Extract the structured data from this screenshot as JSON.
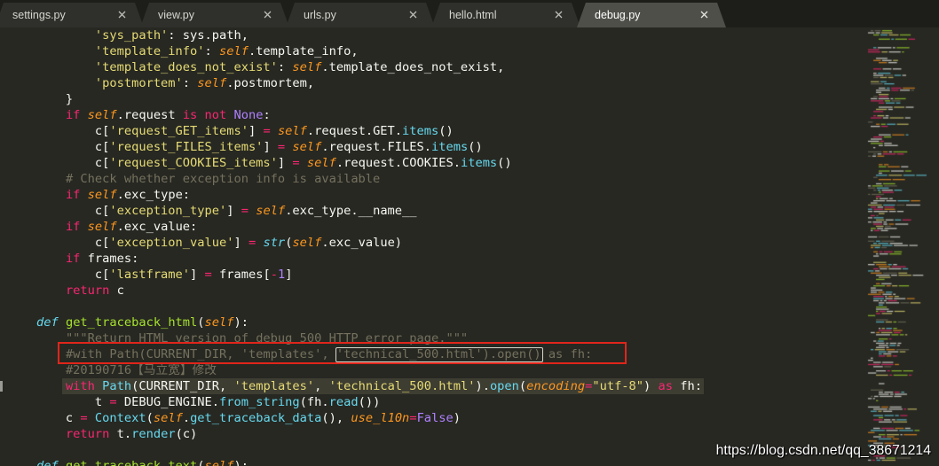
{
  "tabs": [
    {
      "label": "settings.py",
      "active": false
    },
    {
      "label": "view.py",
      "active": false
    },
    {
      "label": "urls.py",
      "active": false
    },
    {
      "label": "hello.html",
      "active": false
    },
    {
      "label": "debug.py",
      "active": true
    }
  ],
  "tab_close_icon": "close-icon",
  "ui_colors": {
    "background": "#272822",
    "tab_bar": "#1d1e1a",
    "tab": "#2f302b",
    "tab_active": "#4e4f49",
    "tab_text": "#d6d6d0",
    "tab_text_active": "#ffffff",
    "line_highlight": "#3e3d32",
    "gutter_mark": "#9a9a94",
    "bracket_outline": "#d8d8cc",
    "annotation_box": "#e0251b"
  },
  "syntax_colors": {
    "plain": "#F8F8F2",
    "keyword": "#F92672",
    "string": "#E6DB74",
    "param": "#FD971F",
    "constant": "#AE81FF",
    "call": "#66D9EF",
    "storage": "#66D9EF",
    "name": "#A6E22E",
    "comment": "#75715E"
  },
  "editor": {
    "lines": [
      [
        {
          "plain": "            "
        },
        {
          "string": "'sys_path'"
        },
        {
          "plain": ": sys.path,"
        }
      ],
      [
        {
          "plain": "            "
        },
        {
          "string": "'template_info'"
        },
        {
          "plain": ": "
        },
        {
          "param": "self"
        },
        {
          "plain": ".template_info,"
        }
      ],
      [
        {
          "plain": "            "
        },
        {
          "string": "'template_does_not_exist'"
        },
        {
          "plain": ": "
        },
        {
          "param": "self"
        },
        {
          "plain": ".template_does_not_exist,"
        }
      ],
      [
        {
          "plain": "            "
        },
        {
          "string": "'postmortem'"
        },
        {
          "plain": ": "
        },
        {
          "param": "self"
        },
        {
          "plain": ".postmortem,"
        }
      ],
      [
        {
          "plain": "        }"
        }
      ],
      [
        {
          "plain": "        "
        },
        {
          "keyword": "if"
        },
        {
          "plain": " "
        },
        {
          "param": "self"
        },
        {
          "plain": ".request "
        },
        {
          "keyword": "is"
        },
        {
          "plain": " "
        },
        {
          "keyword": "not"
        },
        {
          "plain": " "
        },
        {
          "constant": "None"
        },
        {
          "plain": ":"
        }
      ],
      [
        {
          "plain": "            c["
        },
        {
          "string": "'request_GET_items'"
        },
        {
          "plain": "] "
        },
        {
          "keyword": "="
        },
        {
          "plain": " "
        },
        {
          "param": "self"
        },
        {
          "plain": ".request.GET."
        },
        {
          "call": "items"
        },
        {
          "plain": "()"
        }
      ],
      [
        {
          "plain": "            c["
        },
        {
          "string": "'request_FILES_items'"
        },
        {
          "plain": "] "
        },
        {
          "keyword": "="
        },
        {
          "plain": " "
        },
        {
          "param": "self"
        },
        {
          "plain": ".request.FILES."
        },
        {
          "call": "items"
        },
        {
          "plain": "()"
        }
      ],
      [
        {
          "plain": "            c["
        },
        {
          "string": "'request_COOKIES_items'"
        },
        {
          "plain": "] "
        },
        {
          "keyword": "="
        },
        {
          "plain": " "
        },
        {
          "param": "self"
        },
        {
          "plain": ".request.COOKIES."
        },
        {
          "call": "items"
        },
        {
          "plain": "()"
        }
      ],
      [
        {
          "plain": "        "
        },
        {
          "comment": "# Check whether exception info is available"
        }
      ],
      [
        {
          "plain": "        "
        },
        {
          "keyword": "if"
        },
        {
          "plain": " "
        },
        {
          "param": "self"
        },
        {
          "plain": ".exc_type:"
        }
      ],
      [
        {
          "plain": "            c["
        },
        {
          "string": "'exception_type'"
        },
        {
          "plain": "] "
        },
        {
          "keyword": "="
        },
        {
          "plain": " "
        },
        {
          "param": "self"
        },
        {
          "plain": ".exc_type.__name__"
        }
      ],
      [
        {
          "plain": "        "
        },
        {
          "keyword": "if"
        },
        {
          "plain": " "
        },
        {
          "param": "self"
        },
        {
          "plain": ".exc_value:"
        }
      ],
      [
        {
          "plain": "            c["
        },
        {
          "string": "'exception_value'"
        },
        {
          "plain": "] "
        },
        {
          "keyword": "="
        },
        {
          "plain": " "
        },
        {
          "storage": "str"
        },
        {
          "plain": "("
        },
        {
          "param": "self"
        },
        {
          "plain": ".exc_value)"
        }
      ],
      [
        {
          "plain": "        "
        },
        {
          "keyword": "if"
        },
        {
          "plain": " frames:"
        }
      ],
      [
        {
          "plain": "            c["
        },
        {
          "string": "'lastframe'"
        },
        {
          "plain": "] "
        },
        {
          "keyword": "="
        },
        {
          "plain": " frames["
        },
        {
          "keyword": "-"
        },
        {
          "constant": "1"
        },
        {
          "plain": "]"
        }
      ],
      [
        {
          "plain": "        "
        },
        {
          "keyword": "return"
        },
        {
          "plain": " c"
        }
      ],
      [],
      [
        {
          "plain": "    "
        },
        {
          "storage": "def"
        },
        {
          "plain": " "
        },
        {
          "name": "get_traceback_html"
        },
        {
          "plain": "("
        },
        {
          "param": "self"
        },
        {
          "plain": "):"
        }
      ],
      [
        {
          "plain": "        "
        },
        {
          "comment": "\"\"\"Return HTML version of debug 500 HTTP error page.\"\"\""
        }
      ],
      [
        {
          "plain": "        "
        },
        {
          "comment": "#with Path(CURRENT_DIR, 'templates', 'technical_500.html').open() as fh:"
        }
      ],
      [
        {
          "plain": "        "
        },
        {
          "comment": "#20190716【马立宽】修改"
        }
      ],
      [
        {
          "plain": "        "
        },
        {
          "keyword": "with"
        },
        {
          "plain": " "
        },
        {
          "call": "Path"
        },
        {
          "plain": "(CURRENT_DIR, "
        },
        {
          "string": "'templates'"
        },
        {
          "plain": ", "
        },
        {
          "string": "'technical_500.html'"
        },
        {
          "plain": ")."
        },
        {
          "call": "open"
        },
        {
          "plain": "("
        },
        {
          "param": "encoding"
        },
        {
          "keyword": "="
        },
        {
          "string": "\"utf-8\""
        },
        {
          "plain": ") "
        },
        {
          "keyword": "as"
        },
        {
          "plain": " fh:"
        }
      ],
      [
        {
          "plain": "            t "
        },
        {
          "keyword": "="
        },
        {
          "plain": " DEBUG_ENGINE."
        },
        {
          "call": "from_string"
        },
        {
          "plain": "(fh."
        },
        {
          "call": "read"
        },
        {
          "plain": "())"
        }
      ],
      [
        {
          "plain": "        c "
        },
        {
          "keyword": "="
        },
        {
          "plain": " "
        },
        {
          "call": "Context"
        },
        {
          "plain": "("
        },
        {
          "param": "self"
        },
        {
          "plain": "."
        },
        {
          "call": "get_traceback_data"
        },
        {
          "plain": "(), "
        },
        {
          "param": "use_l10n"
        },
        {
          "keyword": "="
        },
        {
          "constant": "False"
        },
        {
          "plain": ")"
        }
      ],
      [
        {
          "plain": "        "
        },
        {
          "keyword": "return"
        },
        {
          "plain": " t."
        },
        {
          "call": "render"
        },
        {
          "plain": "(c)"
        }
      ],
      [],
      [
        {
          "plain": "    "
        },
        {
          "storage": "def"
        },
        {
          "plain": " "
        },
        {
          "name": "get_traceback_text"
        },
        {
          "plain": "("
        },
        {
          "param": "self"
        },
        {
          "plain": "):"
        }
      ]
    ]
  },
  "watermark": "https://blog.csdn.net/qq_38671214"
}
